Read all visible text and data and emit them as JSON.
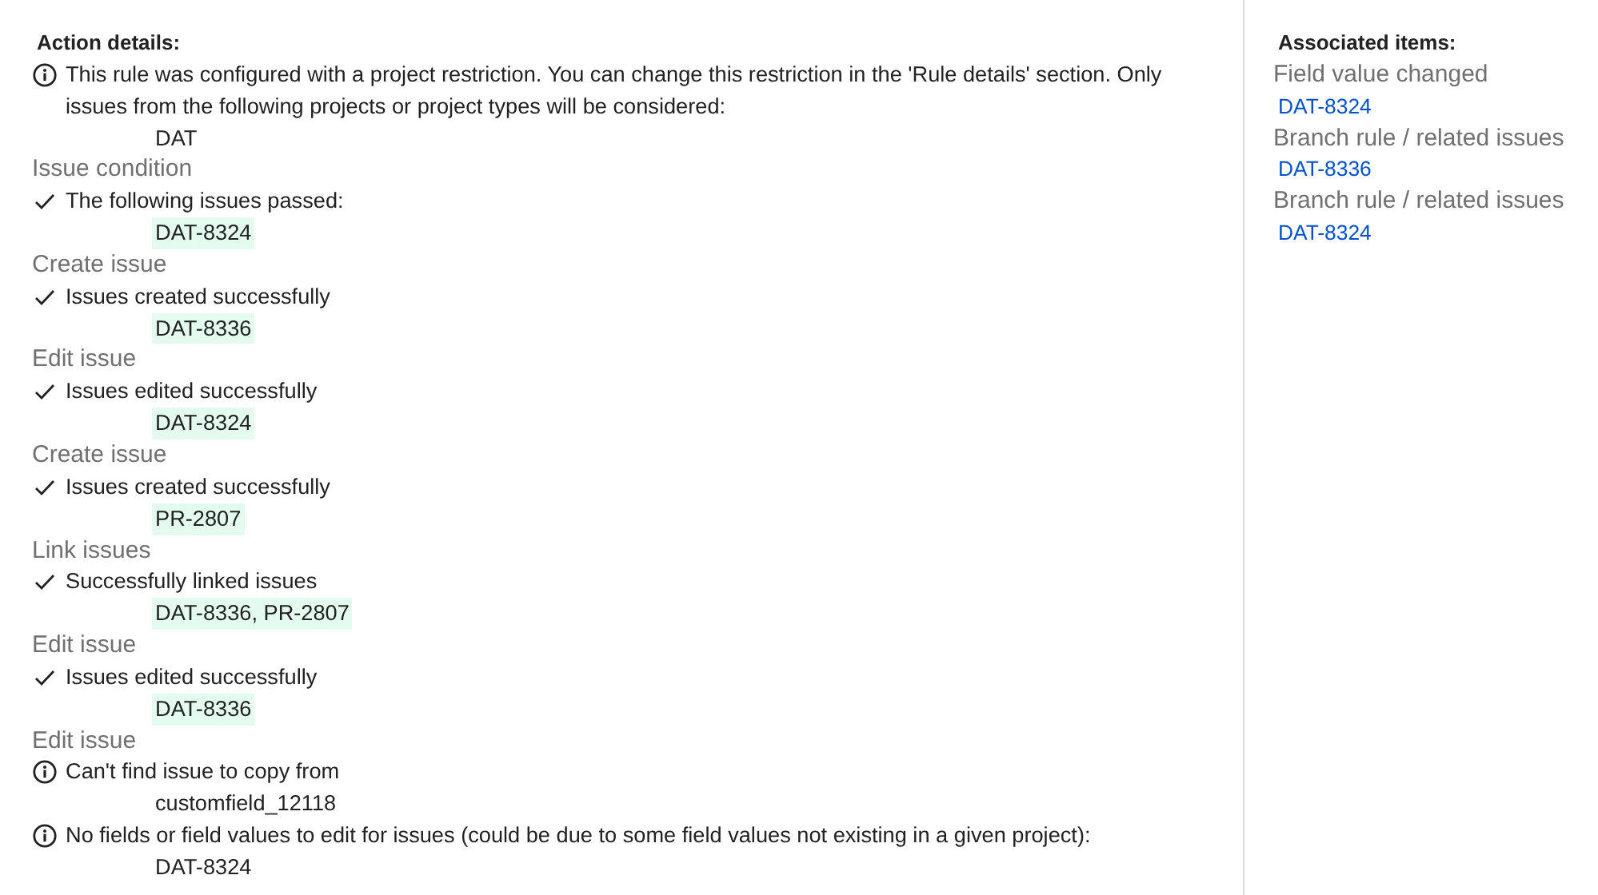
{
  "action_details": {
    "title": "Action details:",
    "entries": [
      {
        "messages": [
          {
            "kind": "info",
            "text": "This rule was configured with a project restriction. You can change this restriction in the 'Rule details' section. Only issues from the following projects or project types will be considered:",
            "items": [
              {
                "text": "DAT",
                "highlighted": false
              }
            ]
          }
        ]
      },
      {
        "heading": "Issue condition",
        "messages": [
          {
            "kind": "success",
            "text": "The following issues passed:",
            "items": [
              {
                "text": "DAT-8324",
                "highlighted": true
              }
            ]
          }
        ]
      },
      {
        "heading": "Create issue",
        "messages": [
          {
            "kind": "success",
            "text": "Issues created successfully",
            "items": [
              {
                "text": "DAT-8336",
                "highlighted": true
              }
            ]
          }
        ]
      },
      {
        "heading": "Edit issue",
        "messages": [
          {
            "kind": "success",
            "text": "Issues edited successfully",
            "items": [
              {
                "text": "DAT-8324",
                "highlighted": true
              }
            ]
          }
        ]
      },
      {
        "heading": "Create issue",
        "messages": [
          {
            "kind": "success",
            "text": "Issues created successfully",
            "items": [
              {
                "text": "PR-2807",
                "highlighted": true
              }
            ]
          }
        ]
      },
      {
        "heading": "Link issues",
        "messages": [
          {
            "kind": "success",
            "text": "Successfully linked issues",
            "items": [
              {
                "text": "DAT-8336, PR-2807",
                "highlighted": true
              }
            ]
          }
        ]
      },
      {
        "heading": "Edit issue",
        "messages": [
          {
            "kind": "success",
            "text": "Issues edited successfully",
            "items": [
              {
                "text": "DAT-8336",
                "highlighted": true
              }
            ]
          }
        ]
      },
      {
        "heading": "Edit issue",
        "messages": [
          {
            "kind": "info",
            "text": "Can't find issue to copy from",
            "items": [
              {
                "text": "customfield_12118",
                "highlighted": false
              }
            ]
          },
          {
            "kind": "info",
            "text": "No fields or field values to edit for issues (could be due to some field values not existing in a given project):",
            "items": [
              {
                "text": "DAT-8324",
                "highlighted": false
              }
            ]
          }
        ]
      }
    ]
  },
  "associated_items": {
    "title": "Associated items:",
    "items": [
      {
        "label": "Field value changed",
        "link": "DAT-8324"
      },
      {
        "label": "Branch rule / related issues",
        "link": "DAT-8336"
      },
      {
        "label": "Branch rule / related issues",
        "link": "DAT-8324"
      }
    ]
  }
}
